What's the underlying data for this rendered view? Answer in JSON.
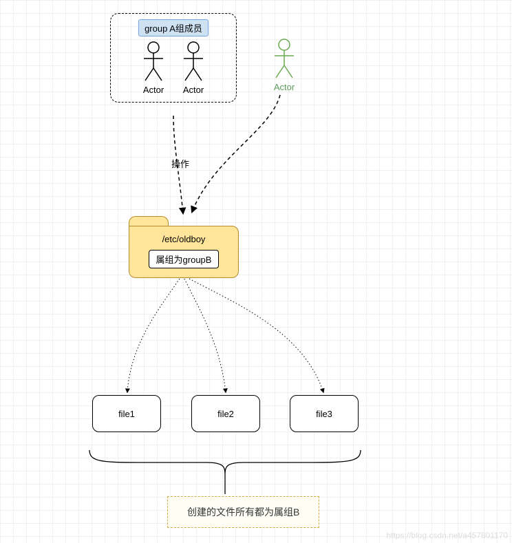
{
  "groupA": {
    "title": "group A组成员",
    "actors": [
      {
        "label": "Actor"
      },
      {
        "label": "Actor"
      }
    ]
  },
  "externalActor": {
    "label": "Actor"
  },
  "edge": {
    "operateLabel": "操作"
  },
  "folder": {
    "path": "/etc/oldboy",
    "groupLabel": "属组为groupB"
  },
  "files": [
    {
      "name": "file1"
    },
    {
      "name": "file2"
    },
    {
      "name": "file3"
    }
  ],
  "note": "创建的文件所有都为属组B",
  "watermark": "https://blog.csdn.net/a457801170"
}
